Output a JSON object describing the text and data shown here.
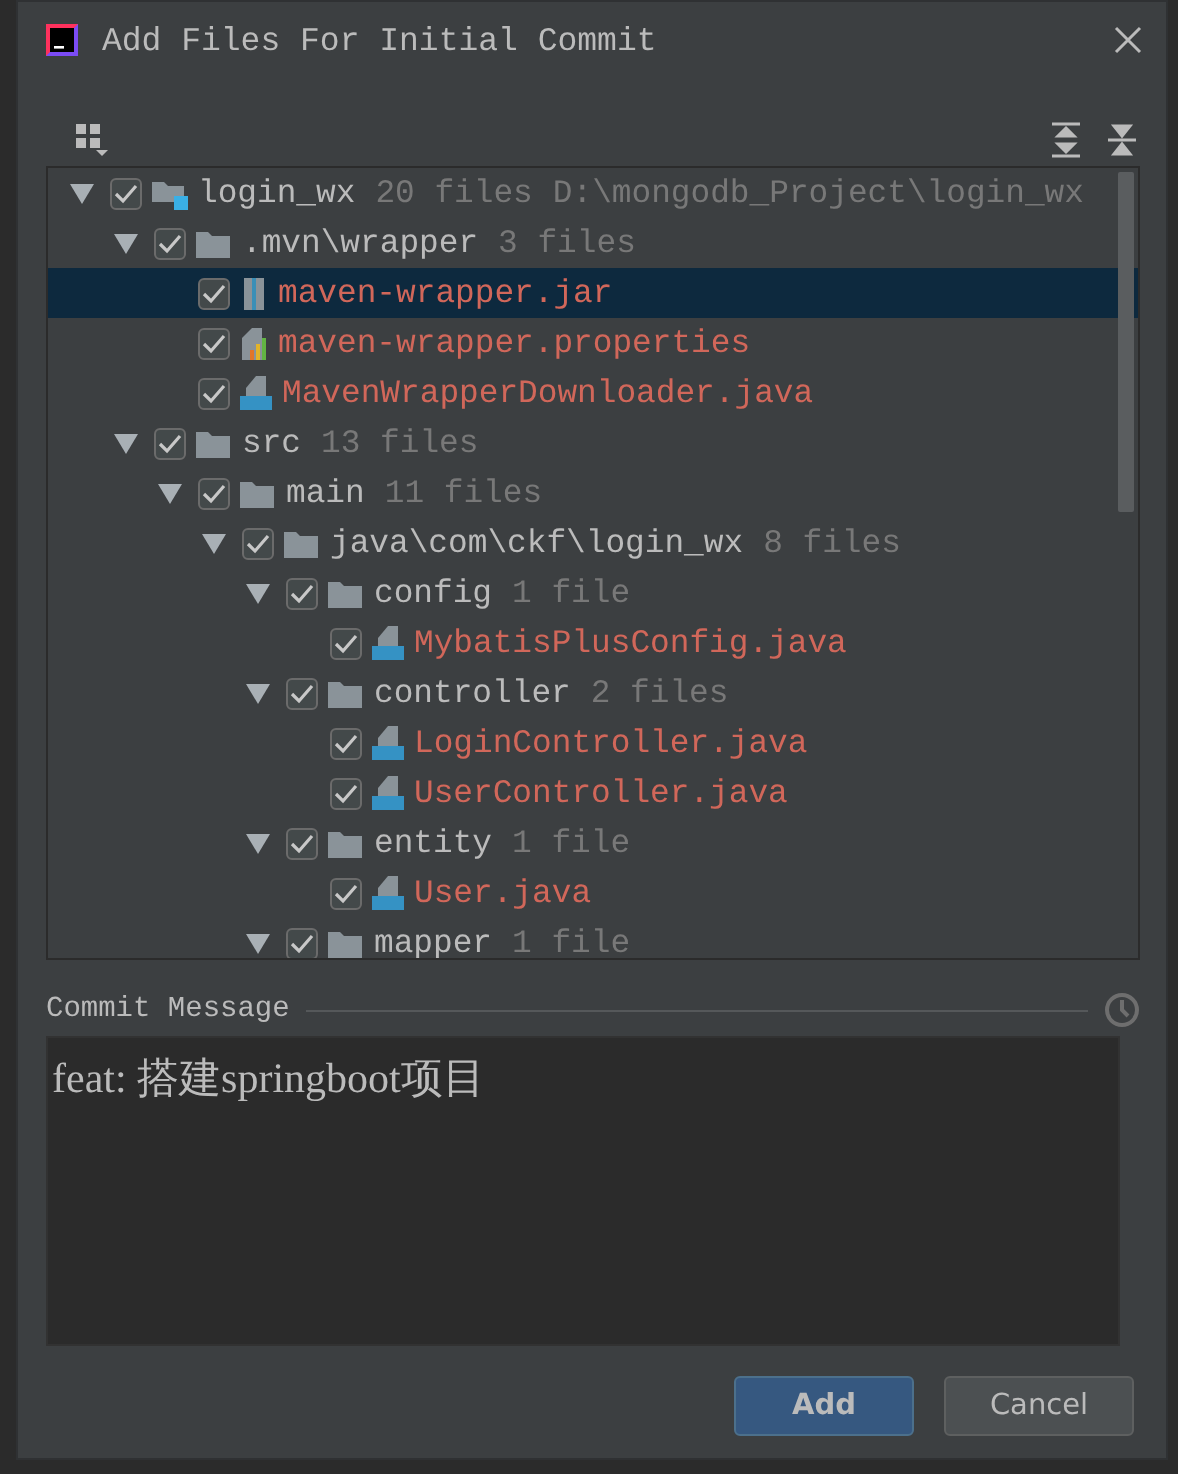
{
  "window": {
    "title": "Add Files For Initial Commit"
  },
  "tree": [
    {
      "kind": "module",
      "name": "login_wx",
      "count": "20 files",
      "path": "D:\\mongodb_Project\\login_wx",
      "checked": true,
      "expanded": true,
      "selected": false,
      "children": [
        {
          "kind": "folder",
          "name": ".mvn\\wrapper",
          "count": "3 files",
          "checked": true,
          "expanded": true,
          "selected": false,
          "children": [
            {
              "kind": "jar",
              "name": "maven-wrapper.jar",
              "checked": true,
              "selected": true
            },
            {
              "kind": "properties",
              "name": "maven-wrapper.properties",
              "checked": true,
              "selected": false
            },
            {
              "kind": "java",
              "name": "MavenWrapperDownloader.java",
              "checked": true,
              "selected": false
            }
          ]
        },
        {
          "kind": "folder",
          "name": "src",
          "count": "13 files",
          "checked": true,
          "expanded": true,
          "selected": false,
          "children": [
            {
              "kind": "folder",
              "name": "main",
              "count": "11 files",
              "checked": true,
              "expanded": true,
              "selected": false,
              "children": [
                {
                  "kind": "folder",
                  "name": "java\\com\\ckf\\login_wx",
                  "count": "8 files",
                  "checked": true,
                  "expanded": true,
                  "selected": false,
                  "children": [
                    {
                      "kind": "folder",
                      "name": "config",
                      "count": "1 file",
                      "checked": true,
                      "expanded": true,
                      "selected": false,
                      "children": [
                        {
                          "kind": "java",
                          "name": "MybatisPlusConfig.java",
                          "checked": true,
                          "selected": false
                        }
                      ]
                    },
                    {
                      "kind": "folder",
                      "name": "controller",
                      "count": "2 files",
                      "checked": true,
                      "expanded": true,
                      "selected": false,
                      "children": [
                        {
                          "kind": "java",
                          "name": "LoginController.java",
                          "checked": true,
                          "selected": false
                        },
                        {
                          "kind": "java",
                          "name": "UserController.java",
                          "checked": true,
                          "selected": false
                        }
                      ]
                    },
                    {
                      "kind": "folder",
                      "name": "entity",
                      "count": "1 file",
                      "checked": true,
                      "expanded": true,
                      "selected": false,
                      "children": [
                        {
                          "kind": "java",
                          "name": "User.java",
                          "checked": true,
                          "selected": false
                        }
                      ]
                    },
                    {
                      "kind": "folder",
                      "name": "mapper",
                      "count": "1 file",
                      "checked": true,
                      "expanded": true,
                      "selected": false
                    }
                  ]
                }
              ]
            }
          ]
        }
      ]
    }
  ],
  "commit_message": {
    "label": "Commit Message",
    "value": "feat: 搭建springboot项目"
  },
  "buttons": [
    {
      "label": "Add",
      "kind": "primary"
    },
    {
      "label": "Cancel",
      "kind": "secondary"
    }
  ]
}
